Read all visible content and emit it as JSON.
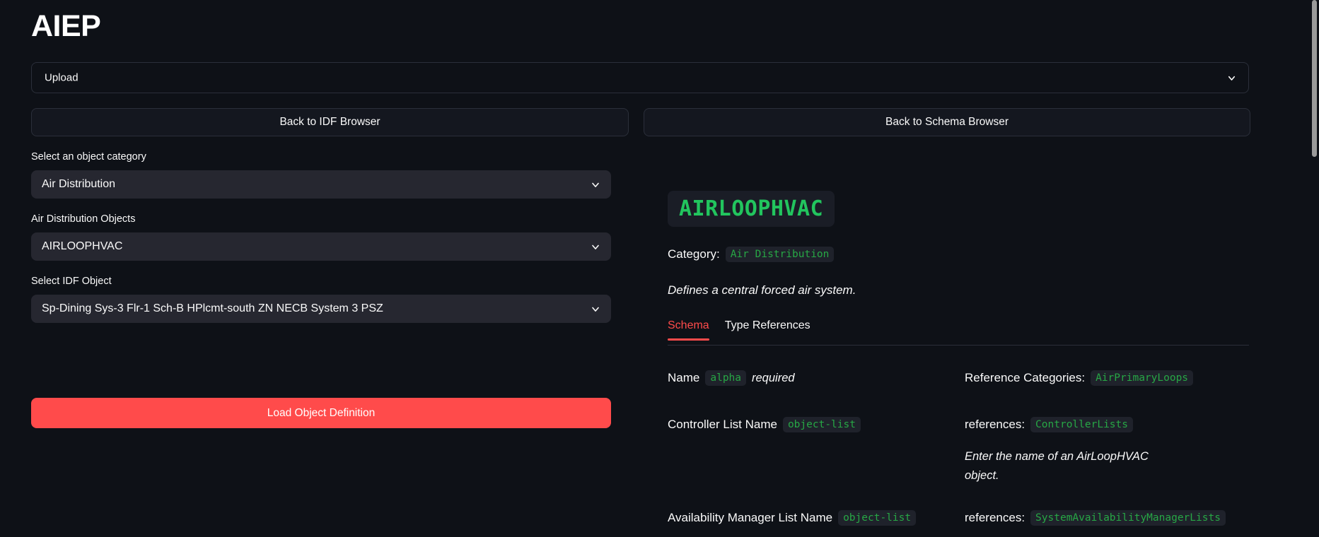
{
  "app": {
    "title": "AIEP"
  },
  "upload": {
    "label": "Upload",
    "chevron_icon": "chevron-down-icon"
  },
  "nav": {
    "back_idf": "Back to IDF Browser",
    "back_schema": "Back to Schema Browser"
  },
  "left_panel": {
    "category": {
      "label": "Select an object category",
      "value": "Air Distribution",
      "chevron_icon": "chevron-down-icon"
    },
    "objects": {
      "label": "Air Distribution Objects",
      "value": "AIRLOOPHVAC",
      "chevron_icon": "chevron-down-icon"
    },
    "idf_object": {
      "label": "Select IDF Object",
      "value": "Sp-Dining Sys-3 Flr-1 Sch-B HPlcmt-south ZN NECB System 3 PSZ",
      "chevron_icon": "chevron-down-icon"
    },
    "load_button": "Load Object Definition"
  },
  "right_panel": {
    "object_name": "AIRLOOPHVAC",
    "category_label": "Category:",
    "category_value": "Air Distribution",
    "description": "Defines a central forced air system.",
    "tabs": [
      {
        "label": "Schema",
        "active": true
      },
      {
        "label": "Type References",
        "active": false
      }
    ],
    "schema_rows": [
      {
        "field_name": "Name",
        "field_type": "alpha",
        "required_text": "required",
        "right_label": "Reference Categories:",
        "right_value": "AirPrimaryLoops",
        "note": ""
      },
      {
        "field_name": "Controller List Name",
        "field_type": "object-list",
        "required_text": "",
        "right_label": "references:",
        "right_value": "ControllerLists",
        "note": "Enter the name of an AirLoopHVAC object."
      },
      {
        "field_name": "Availability Manager List Name",
        "field_type": "object-list",
        "required_text": "",
        "right_label": "references:",
        "right_value": "SystemAvailabilityManagerLists",
        "note": ""
      }
    ]
  },
  "scrollbar": {
    "thumb_label": "vertical-scrollbar"
  },
  "colors": {
    "background": "#0e1117",
    "accent_red": "#ff4b4b",
    "code_green": "#27a745",
    "title_green": "#22c55e",
    "widget_bg": "#262730"
  }
}
